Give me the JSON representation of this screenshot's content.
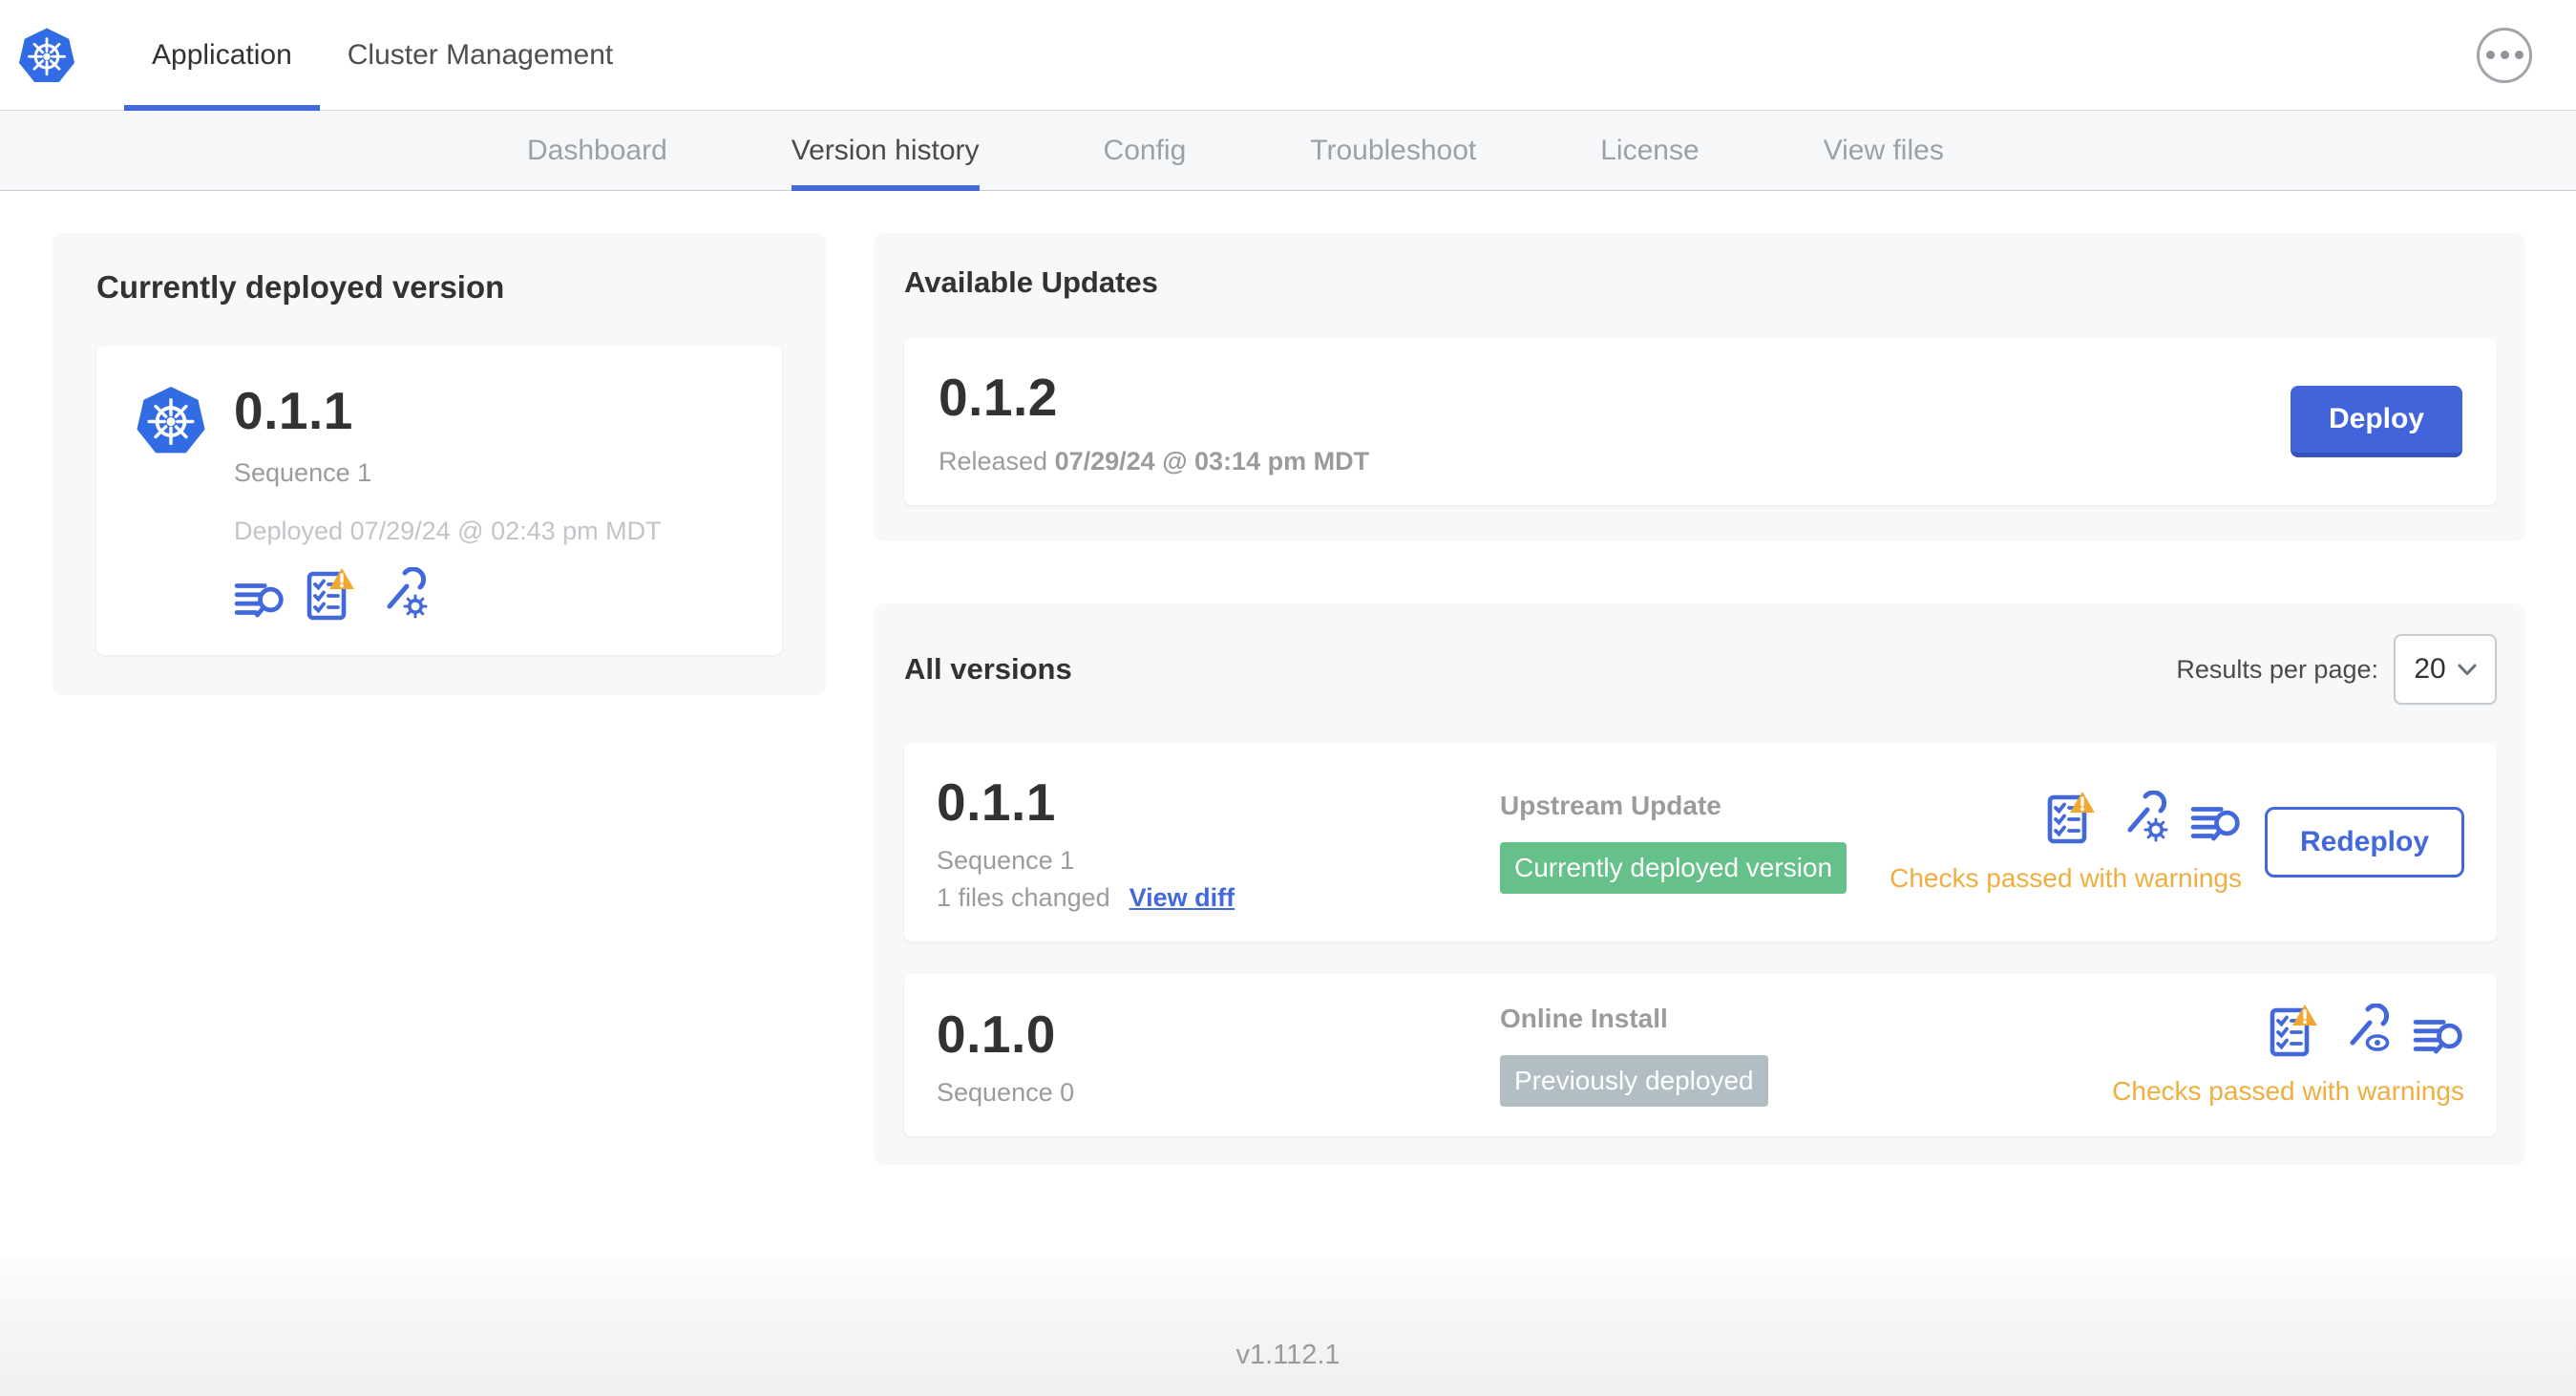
{
  "header": {
    "tabs": [
      {
        "label": "Application"
      },
      {
        "label": "Cluster Management"
      }
    ]
  },
  "subnav": {
    "tabs": [
      {
        "label": "Dashboard"
      },
      {
        "label": "Version history"
      },
      {
        "label": "Config"
      },
      {
        "label": "Troubleshoot"
      },
      {
        "label": "License"
      },
      {
        "label": "View files"
      }
    ]
  },
  "deployed": {
    "title": "Currently deployed version",
    "version": "0.1.1",
    "sequence": "Sequence 1",
    "deployed_at": "Deployed 07/29/24 @ 02:43 pm MDT"
  },
  "updates": {
    "title": "Available Updates",
    "version": "0.1.2",
    "released_prefix": "Released",
    "released_date": "07/29/24 @ 03:14 pm MDT",
    "deploy_label": "Deploy"
  },
  "all_versions": {
    "title": "All versions",
    "results_label": "Results per page:",
    "results_value": "20",
    "rows": [
      {
        "version": "0.1.1",
        "sequence": "Sequence 1",
        "files_changed": "1 files changed",
        "view_diff_label": "View diff",
        "source": "Upstream Update",
        "badge": "Currently deployed version",
        "status": "Checks passed with warnings",
        "action_label": "Redeploy"
      },
      {
        "version": "0.1.0",
        "sequence": "Sequence 0",
        "source": "Online Install",
        "badge": "Previously deployed",
        "status": "Checks passed with warnings"
      }
    ]
  },
  "footer": {
    "version": "v1.112.1"
  },
  "icons": {
    "logo": "kubernetes-logo",
    "menu": "ellipsis-menu-icon",
    "logs": "deploy-logs-icon",
    "preflight": "preflight-checks-warning-icon",
    "edit_config": "edit-config-icon",
    "view_config": "view-config-icon",
    "chevron": "chevron-down-icon"
  },
  "colors": {
    "accent_blue": "#4368dc",
    "kubernetes_blue": "#326ce5",
    "badge_green": "#65c089",
    "badge_gray": "#b3bec4",
    "warning_orange": "#efae3f"
  }
}
